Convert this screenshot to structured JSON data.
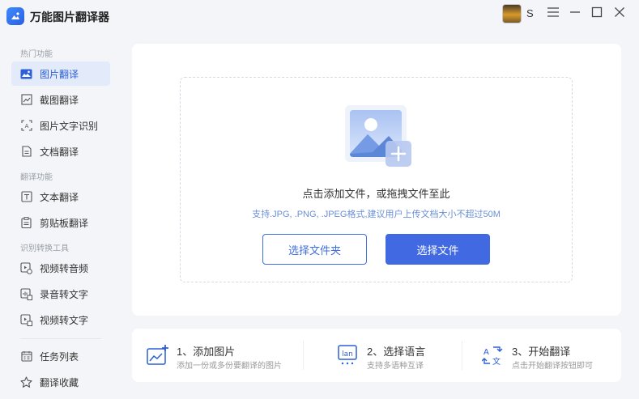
{
  "app": {
    "title": "万能图片翻译器"
  },
  "user": {
    "name": "S"
  },
  "sidebar": {
    "groups": [
      {
        "label": "热门功能",
        "items": [
          {
            "label": "图片翻译",
            "icon": "image-icon",
            "active": true
          },
          {
            "label": "截图翻译",
            "icon": "screenshot-icon"
          },
          {
            "label": "图片文字识别",
            "icon": "ocr-icon"
          },
          {
            "label": "文档翻译",
            "icon": "document-icon"
          }
        ]
      },
      {
        "label": "翻译功能",
        "items": [
          {
            "label": "文本翻译",
            "icon": "text-icon"
          },
          {
            "label": "剪贴板翻译",
            "icon": "clipboard-icon"
          }
        ]
      },
      {
        "label": "识别转换工具",
        "items": [
          {
            "label": "视频转音频",
            "icon": "video-audio-icon"
          },
          {
            "label": "录音转文字",
            "icon": "recording-icon"
          },
          {
            "label": "视频转文字",
            "icon": "video-text-icon"
          }
        ]
      }
    ],
    "footer": [
      {
        "label": "任务列表",
        "icon": "task-list-icon"
      },
      {
        "label": "翻译收藏",
        "icon": "star-icon"
      }
    ]
  },
  "upload": {
    "title": "点击添加文件，或拖拽文件至此",
    "hint": "支持.JPG, .PNG, .JPEG格式,建议用户上传文档大小不超过50M",
    "folder_button": "选择文件夹",
    "file_button": "选择文件"
  },
  "steps": [
    {
      "title": "1、添加图片",
      "desc": "添加一份或多份要翻译的图片",
      "icon": "add-image-icon"
    },
    {
      "title": "2、选择语言",
      "desc": "支持多语种互译",
      "icon": "language-icon"
    },
    {
      "title": "3、开始翻译",
      "desc": "点击开始翻译按钮即可",
      "icon": "translate-icon"
    }
  ],
  "colors": {
    "accent": "#4169e1",
    "active_bg": "#e3ebfb",
    "background": "#f3f5f8"
  }
}
